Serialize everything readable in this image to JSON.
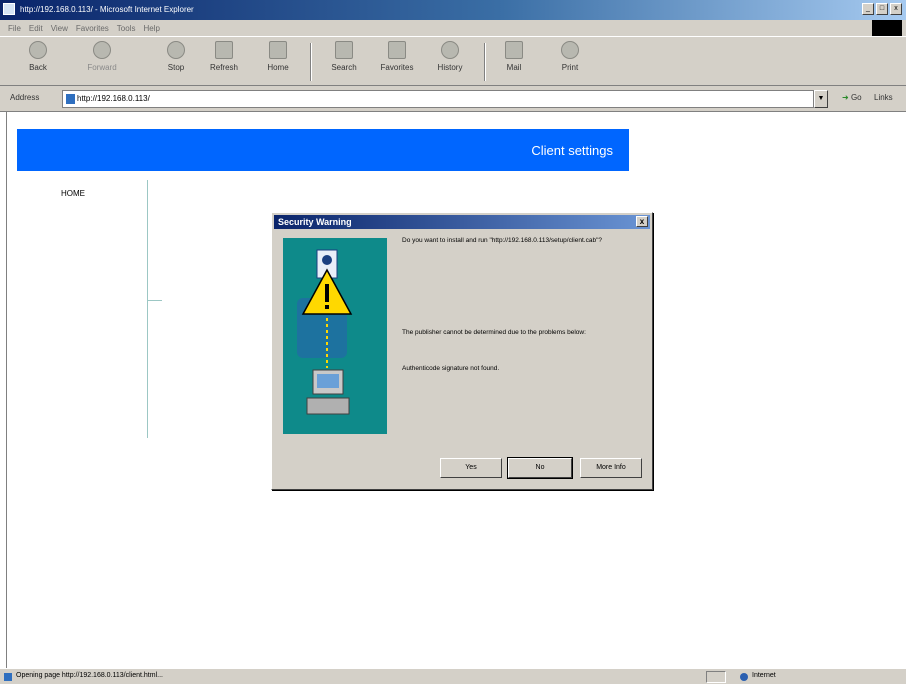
{
  "window": {
    "title": "http://192.168.0.113/ - Microsoft Internet Explorer",
    "controls": [
      "_",
      "□",
      "x"
    ]
  },
  "menu": [
    "File",
    "Edit",
    "View",
    "Favorites",
    "Tools",
    "Help"
  ],
  "toolbar": {
    "back": "Back",
    "forward": "Forward",
    "stop": "Stop",
    "refresh": "Refresh",
    "home": "Home",
    "search": "Search",
    "favorites": "Favorites",
    "history": "History",
    "mail": "Mail",
    "print": "Print"
  },
  "address": {
    "label": "Address",
    "url": "http://192.168.0.113/",
    "go": "Go",
    "links": "Links"
  },
  "page": {
    "banner_title": "Client settings",
    "nav_home": "HOME"
  },
  "dialog": {
    "title": "Security Warning",
    "close": "x",
    "question": "Do you want to install and run \"http://192.168.0.113/setup/client.cab\"?",
    "publisher_note": "The publisher cannot be determined due to the problems below:",
    "problem": "Authenticode signature not found.",
    "buttons": {
      "yes": "Yes",
      "no": "No",
      "more_info": "More Info"
    }
  },
  "status": {
    "text": "Opening page http://192.168.0.113/client.html...",
    "zone": "Internet"
  },
  "colors": {
    "banner": "#0066ff",
    "dialog_art": "#0e8a8a",
    "warning": "#ffd800"
  }
}
